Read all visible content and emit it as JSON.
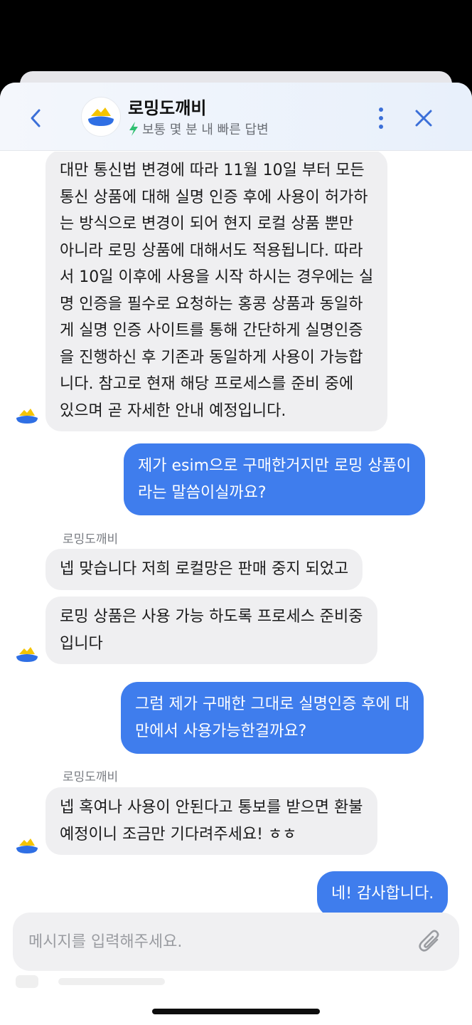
{
  "header": {
    "title": "로밍도깨비",
    "subtitle": "보통 몇 분 내 빠른 답변"
  },
  "messages": [
    {
      "direction": "in",
      "lines": [
        "대만 통신법 변경에 따라 11월 10일 부터 모든",
        "통신 상품에 대해 실명 인증 후에 사용이 허가하",
        "는 방식으로 변경이 되어 현지 로컬 상품 뿐만",
        "아니라 로밍 상품에 대해서도 적용됩니다. 따라",
        "서 10일 이후에 사용을 시작 하시는 경우에는 실",
        "명 인증을 필수로 요청하는 홍콩 상품과 동일하",
        "게 실명 인증 사이트를 통해 간단하게 실명인증",
        "을 진행하신 후 기존과 동일하게 사용이 가능합",
        "니다. 참고로 현재 해당 프로세스를 준비 중에",
        "있으며 곧 자세한 안내 예정입니다."
      ]
    },
    {
      "direction": "out",
      "lines": [
        "제가 esim으로 구매한거지만 로밍 상품이",
        "라는 말씀이실까요?"
      ]
    },
    {
      "direction": "in",
      "sender": "로밍도깨비",
      "lines": [
        "넵 맞습니다 저희 로컬망은 판매 중지 되었고"
      ]
    },
    {
      "direction": "in",
      "lines": [
        "로밍 상품은 사용 가능 하도록 프로세스 준비중",
        "입니다"
      ]
    },
    {
      "direction": "out",
      "lines": [
        "그럼 제가 구매한 그대로 실명인증 후에 대",
        "만에서 사용가능한걸까요?"
      ]
    },
    {
      "direction": "in",
      "sender": "로밍도깨비",
      "lines": [
        "넵 혹여나 사용이 안된다고 통보를 받으면 환불",
        "예정이니 조금만 기다려주세요! ㅎㅎ"
      ]
    },
    {
      "direction": "out",
      "lines": [
        "네! 감사합니다."
      ]
    }
  ],
  "input": {
    "placeholder": "메시지를 입력해주세요."
  },
  "colors": {
    "accent": "#3f7ded",
    "incoming_bubble": "#efeff1",
    "brand_yellow": "#f5c400",
    "brand_blue": "#2f6fe4"
  }
}
